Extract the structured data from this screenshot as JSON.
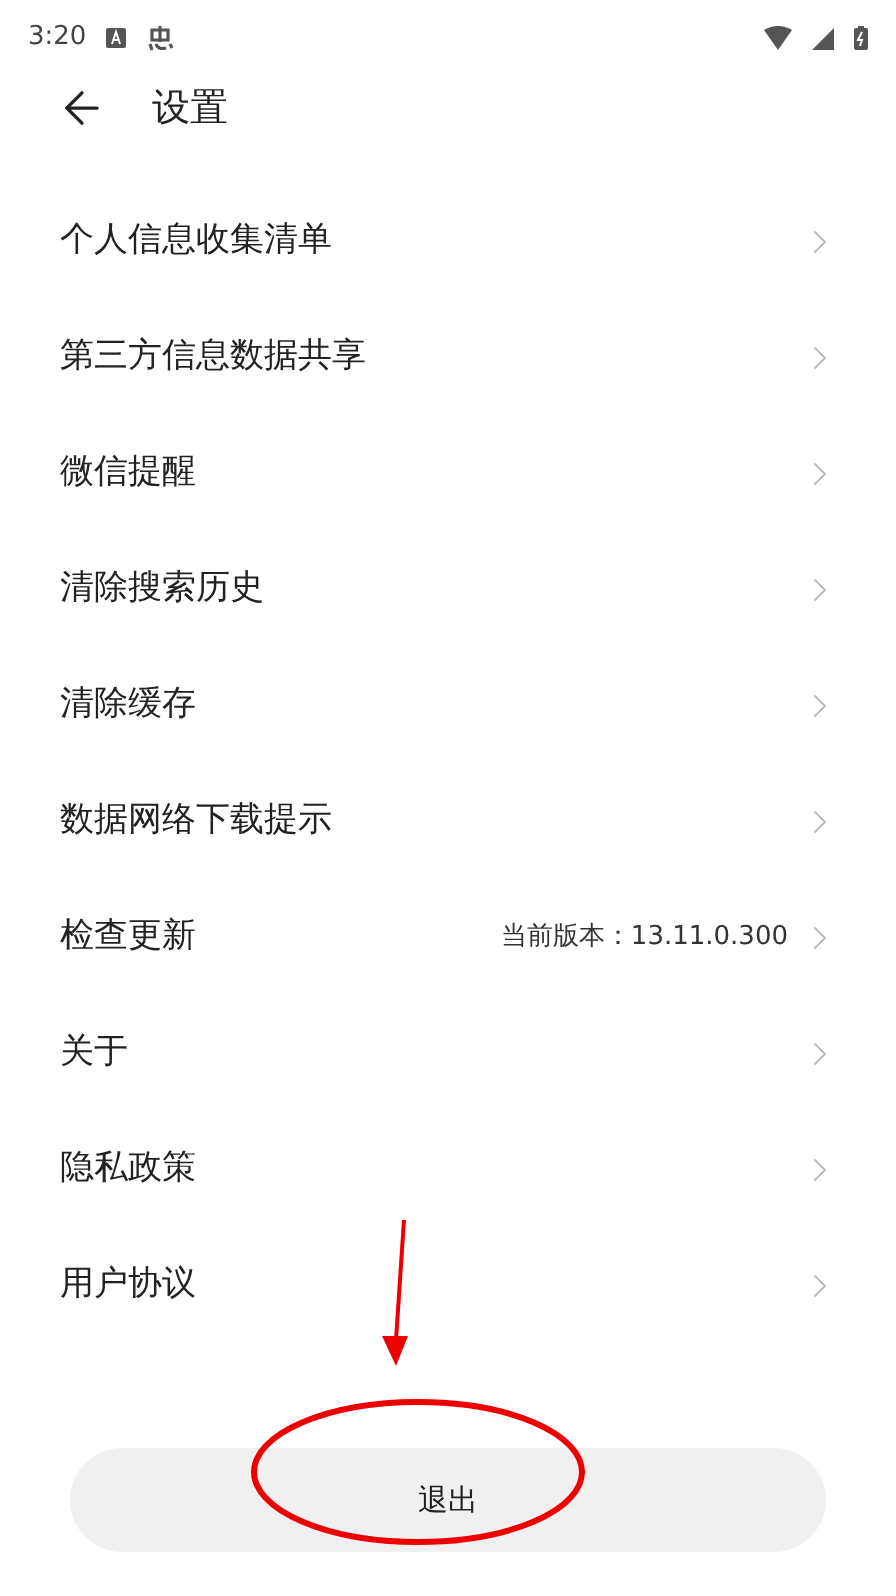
{
  "status_bar": {
    "time": "3:20"
  },
  "header": {
    "title": "设置"
  },
  "items": [
    {
      "label": "个人信息收集清单"
    },
    {
      "label": "第三方信息数据共享"
    },
    {
      "label": "微信提醒"
    },
    {
      "label": "清除搜索历史"
    },
    {
      "label": "清除缓存"
    },
    {
      "label": "数据网络下载提示"
    },
    {
      "label": "检查更新",
      "value": "当前版本：13.11.0.300"
    },
    {
      "label": "关于"
    },
    {
      "label": "隐私政策"
    },
    {
      "label": "用户协议"
    }
  ],
  "logout_button": {
    "label": "退出"
  }
}
